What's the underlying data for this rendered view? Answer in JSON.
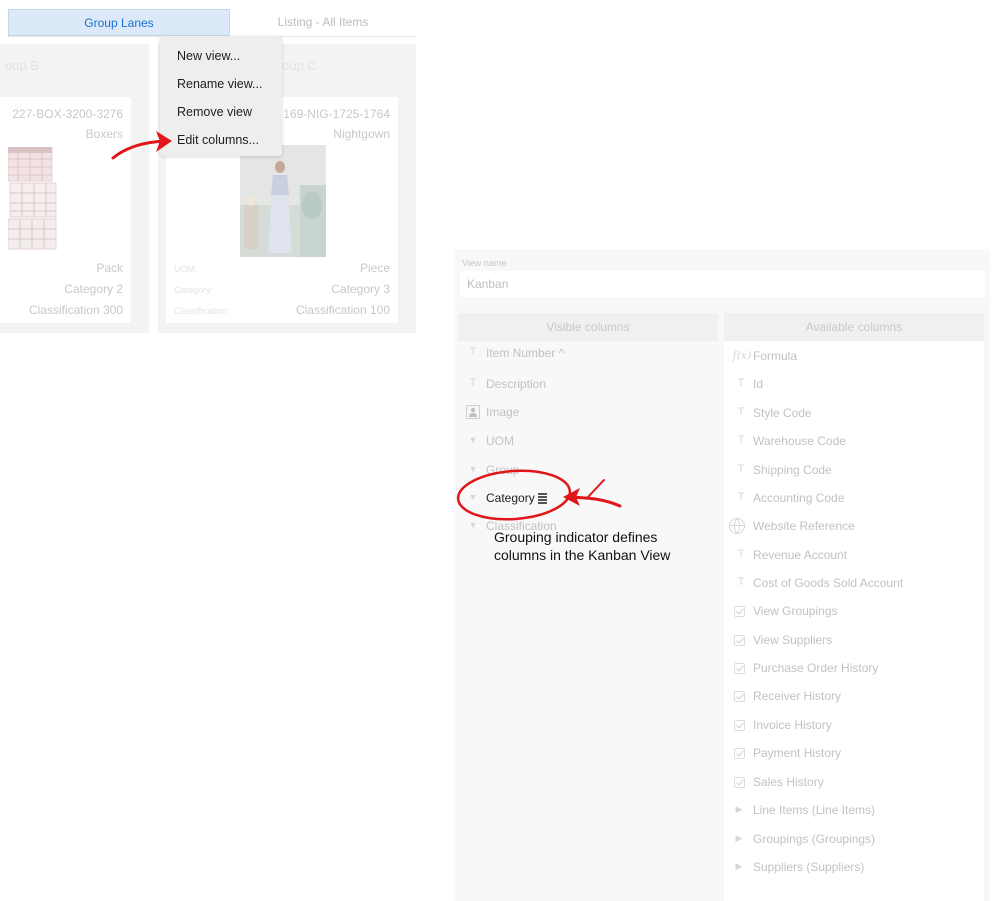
{
  "tabs": {
    "active": "Group Lanes",
    "inactive": "Listing - All Items"
  },
  "lanes": [
    {
      "title": "oup B",
      "sku": "227-BOX-3200-3276",
      "description": "Boxers",
      "uom": "Pack",
      "category": "Category 2",
      "classification": "Classification 300"
    },
    {
      "title": "oup C",
      "sku": "169-NIG-1725-1764",
      "description": "Nightgown",
      "uom": "Piece",
      "category": "Category 3",
      "classification": "Classification 100",
      "labels": {
        "uom": "UOM:",
        "category": "Category:",
        "classification": "Classification:"
      }
    }
  ],
  "context_menu": [
    "New view...",
    "Rename view...",
    "Remove view",
    "Edit columns..."
  ],
  "editor": {
    "view_name_label": "View name",
    "view_name_value": "Kanban",
    "visible_header": "Visible columns",
    "available_header": "Available columns",
    "visible_columns": [
      {
        "label": "Item Number ^",
        "icon": "text-type-icon"
      },
      {
        "label": "Description",
        "icon": "text-type-icon"
      },
      {
        "label": "Image",
        "icon": "image-type-icon"
      },
      {
        "label": "UOM",
        "icon": "dropdown-type-icon"
      },
      {
        "label": "Group",
        "icon": "dropdown-type-icon"
      },
      {
        "label": "Category",
        "icon": "dropdown-type-icon",
        "grouping": true
      },
      {
        "label": "Classification",
        "icon": "dropdown-type-icon"
      }
    ],
    "available_columns": [
      {
        "label": "Formula",
        "icon": "formula-icon"
      },
      {
        "label": "Id",
        "icon": "text-type-icon"
      },
      {
        "label": "Style Code",
        "icon": "text-type-icon"
      },
      {
        "label": "Warehouse Code",
        "icon": "text-type-icon"
      },
      {
        "label": "Shipping Code",
        "icon": "text-type-icon"
      },
      {
        "label": "Accounting Code",
        "icon": "text-type-icon"
      },
      {
        "label": "Website Reference",
        "icon": "globe-icon"
      },
      {
        "label": "Revenue Account",
        "icon": "text-type-icon"
      },
      {
        "label": "Cost of Goods Sold Account",
        "icon": "text-type-icon"
      },
      {
        "label": "View Groupings",
        "icon": "checkbox-icon"
      },
      {
        "label": "View Suppliers",
        "icon": "checkbox-icon"
      },
      {
        "label": "Purchase Order History",
        "icon": "checkbox-icon"
      },
      {
        "label": "Receiver History",
        "icon": "checkbox-icon"
      },
      {
        "label": "Invoice History",
        "icon": "checkbox-icon"
      },
      {
        "label": "Payment History",
        "icon": "checkbox-icon"
      },
      {
        "label": "Sales History",
        "icon": "checkbox-icon"
      },
      {
        "label": "Line Items (Line Items)",
        "icon": "expand-triangle-icon"
      },
      {
        "label": "Groupings (Groupings)",
        "icon": "expand-triangle-icon"
      },
      {
        "label": "Suppliers (Suppliers)",
        "icon": "expand-triangle-icon"
      }
    ],
    "icon_glyphs": {
      "text": "T",
      "dropdown": "▼",
      "expand": "▶",
      "formula": "f(x)"
    }
  },
  "annotation": {
    "line1": "Grouping indicator defines",
    "line2": "columns in the Kanban View"
  },
  "colors": {
    "accent": "#1c6fd1",
    "callout": "#e0161b"
  }
}
